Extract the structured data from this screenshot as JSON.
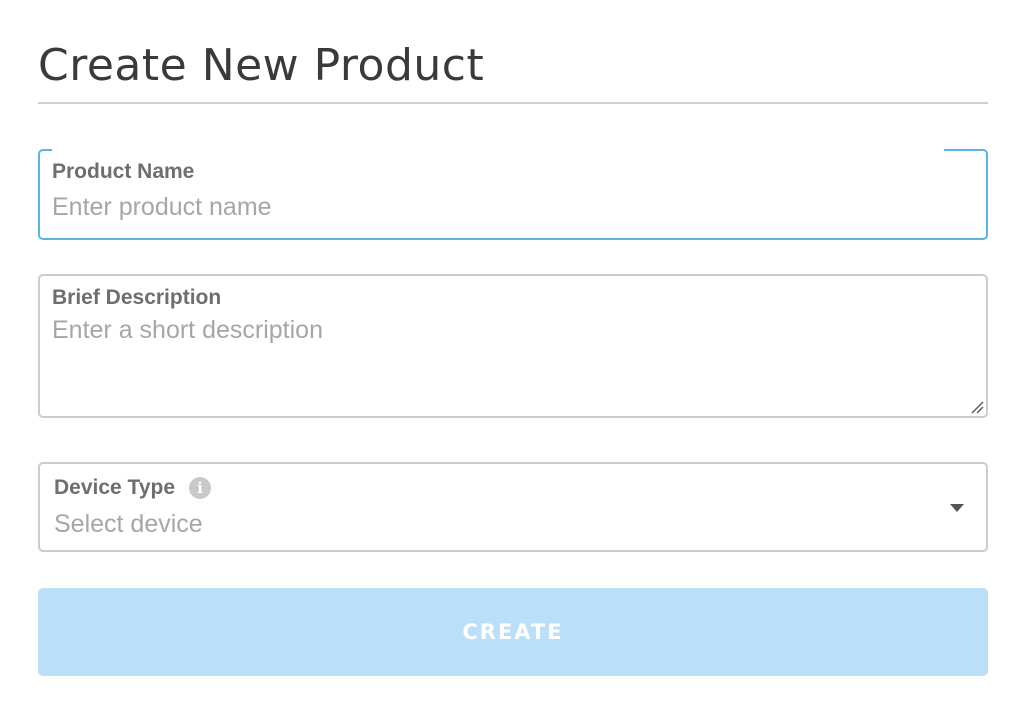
{
  "page": {
    "title": "Create New Product"
  },
  "fields": {
    "product_name": {
      "label": "Product Name",
      "placeholder": "Enter product name",
      "value": ""
    },
    "description": {
      "label": "Brief Description",
      "placeholder": "Enter a short description",
      "value": ""
    },
    "device_type": {
      "label": "Device Type",
      "placeholder": "Select device",
      "info_icon": "info-icon",
      "info_glyph": "i",
      "dropdown_icon": "chevron-down-icon"
    }
  },
  "actions": {
    "create_label": "CREATE"
  },
  "colors": {
    "focus_border": "#5ab4e5",
    "button_background": "#bbdff6",
    "button_text": "#ffffff"
  }
}
